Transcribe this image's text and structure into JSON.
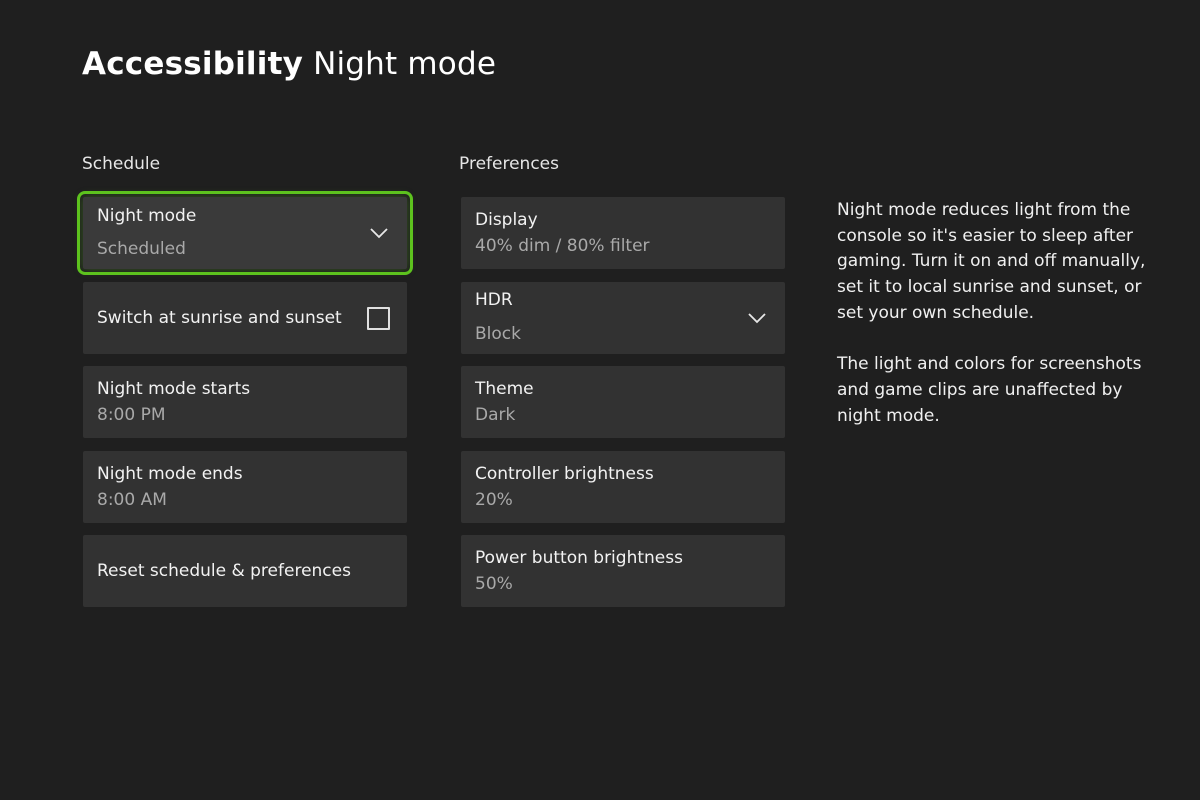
{
  "header": {
    "title_strong": "Accessibility",
    "title_light": "Night mode"
  },
  "schedule": {
    "label": "Schedule",
    "night_mode": {
      "title": "Night mode",
      "value": "Scheduled",
      "icon": "chevron-down-icon"
    },
    "sunrise_sunset": {
      "label": "Switch at sunrise and sunset",
      "checked": false
    },
    "starts": {
      "title": "Night mode starts",
      "value": "8:00 PM"
    },
    "ends": {
      "title": "Night mode ends",
      "value": "8:00 AM"
    },
    "reset": {
      "label": "Reset schedule & preferences"
    }
  },
  "preferences": {
    "label": "Preferences",
    "display": {
      "title": "Display",
      "value": "40% dim / 80% filter"
    },
    "hdr": {
      "title": "HDR",
      "value": "Block",
      "icon": "chevron-down-icon"
    },
    "theme": {
      "title": "Theme",
      "value": "Dark"
    },
    "controller": {
      "title": "Controller brightness",
      "value": "20%"
    },
    "power": {
      "title": "Power button brightness",
      "value": "50%"
    }
  },
  "description": {
    "p1": "Night mode reduces light from the console so it's easier to sleep after gaming. Turn it on and off manually, set it to local sunrise and sunset, or set your own schedule.",
    "p2": "The light and colors for screenshots and game clips are unaffected by night mode."
  },
  "colors": {
    "background": "#1f1f1f",
    "tile": "#323232",
    "focus": "#5dc21e"
  }
}
